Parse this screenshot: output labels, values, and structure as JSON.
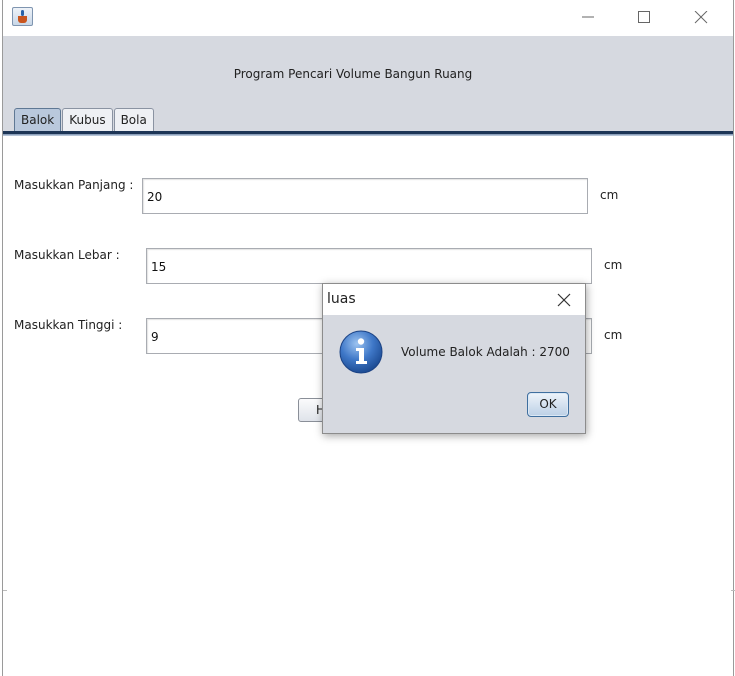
{
  "window": {
    "title": "",
    "controls": {
      "minimize": "minimize-icon",
      "maximize": "maximize-icon",
      "close": "close-icon"
    }
  },
  "header": {
    "title": "Program Pencari Volume Bangun Ruang"
  },
  "tabs": [
    {
      "label": "Balok",
      "active": true
    },
    {
      "label": "Kubus",
      "active": false
    },
    {
      "label": "Bola",
      "active": false
    }
  ],
  "form": {
    "panjang": {
      "label": "Masukkan Panjang :",
      "value": "20",
      "unit": "cm"
    },
    "lebar": {
      "label": "Masukkan Lebar :",
      "value": "15",
      "unit": "cm"
    },
    "tinggi": {
      "label": "Masukkan Tinggi :",
      "value": "9",
      "unit": "cm"
    },
    "hitung_label": "H"
  },
  "dialog": {
    "title": "luas",
    "message": "Volume Balok Adalah : 2700",
    "icon": "info-icon",
    "ok_label": "OK"
  },
  "colors": {
    "header_bg": "#d6d9e0",
    "tab_line": "#1d3556",
    "info_blue": "#2f63b0"
  }
}
